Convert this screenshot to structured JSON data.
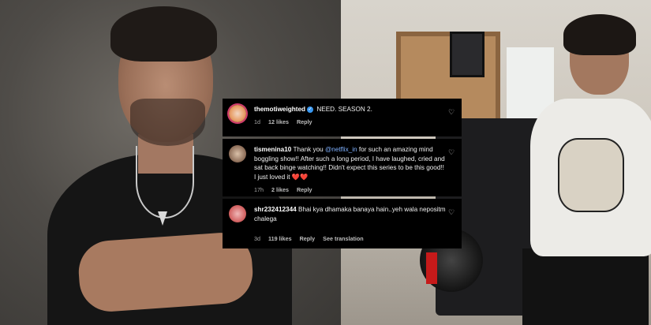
{
  "comments": [
    {
      "username": "themotiweighted",
      "verified": true,
      "text": "NEED. SEASON 2.",
      "time": "1d",
      "likes": "12 likes",
      "reply": "Reply"
    },
    {
      "username": "tismenina10",
      "text_before_mention": "Thank you ",
      "mention": "@netflix_in",
      "text_after_mention": " for such an amazing mind boggling show!! After such a long period, I have laughed, cried and sat back binge watching!! Didn't expect this series to be this good!! I just loved it ",
      "emoji": "❤️❤️",
      "time": "17h",
      "likes": "2 likes",
      "reply": "Reply"
    },
    {
      "username": "shr232412344",
      "text": "Bhai kya dhamaka banaya hain..yeh wala nepositm chalega",
      "time": "3d",
      "likes": "119 likes",
      "reply": "Reply",
      "see_translation": "See translation"
    }
  ],
  "icons": {
    "like": "heart-outline-icon",
    "verified": "verified-badge-icon"
  },
  "colors": {
    "comment_bg": "#000000",
    "mention": "#7fb1ff",
    "verified": "#3897f0",
    "meta": "#a8a8a8"
  }
}
